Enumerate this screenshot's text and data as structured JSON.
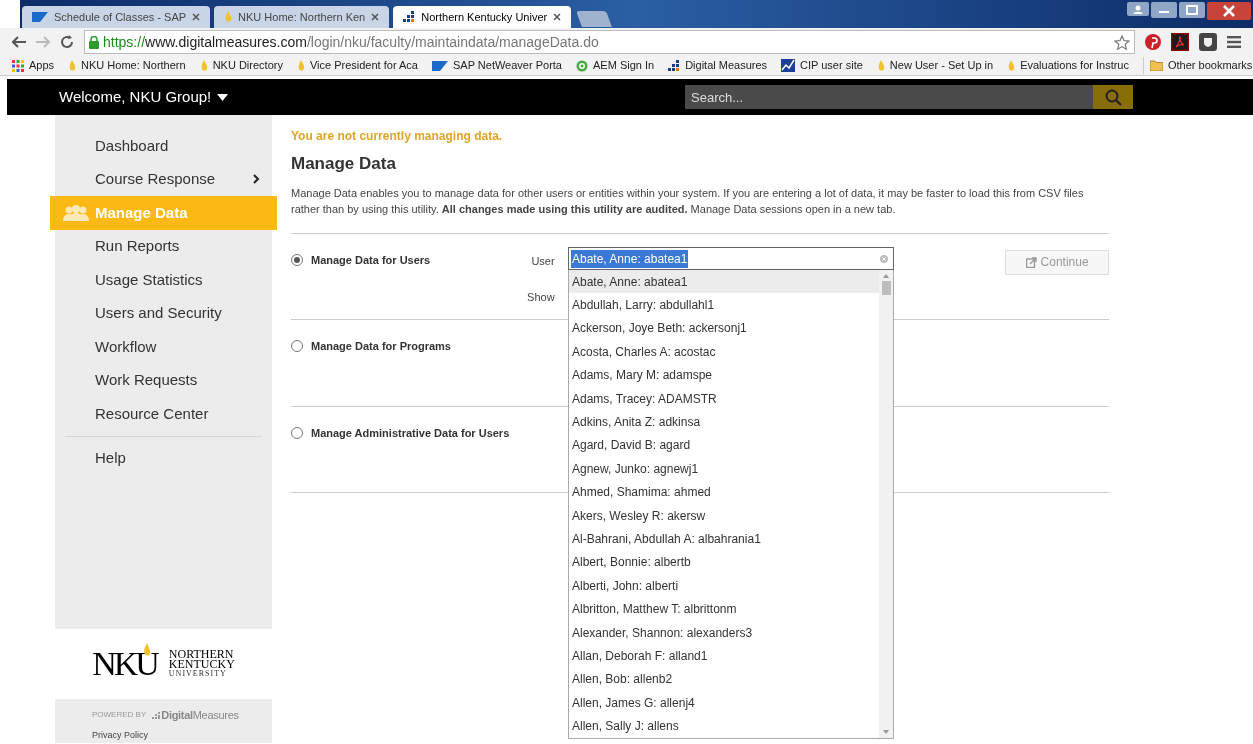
{
  "browser": {
    "tabs": [
      {
        "title": "Schedule of Classes - SAP",
        "kind": "sap",
        "selected": false
      },
      {
        "title": "NKU Home: Northern Ken",
        "kind": "flame",
        "selected": false
      },
      {
        "title": "Northern Kentucky Univer",
        "kind": "dm",
        "selected": true
      }
    ],
    "url_scheme": "https://",
    "url_host": "www.digitalmeasures.com",
    "url_path": "/login/nku/faculty/maintaindata/manageData.do",
    "bookmarks": [
      {
        "label": "Apps",
        "kind": "apps"
      },
      {
        "label": "NKU Home: Northern",
        "kind": "flame"
      },
      {
        "label": "NKU Directory",
        "kind": "flame"
      },
      {
        "label": "Vice President for Aca",
        "kind": "flame"
      },
      {
        "label": "SAP NetWeaver Porta",
        "kind": "sap"
      },
      {
        "label": "AEM Sign In",
        "kind": "aem"
      },
      {
        "label": "Digital Measures",
        "kind": "dm"
      },
      {
        "label": "CIP user site",
        "kind": "cip"
      },
      {
        "label": "New User - Set Up in",
        "kind": "flame"
      },
      {
        "label": "Evaluations for Instruc",
        "kind": "flame"
      }
    ],
    "other_bookmarks": "Other bookmarks"
  },
  "header": {
    "welcome": "Welcome, NKU Group!",
    "search_placeholder": "Search..."
  },
  "sidebar": {
    "items": [
      {
        "label": "Dashboard",
        "selected": false
      },
      {
        "label": "Course Response",
        "selected": false,
        "has_submenu": true
      },
      {
        "label": "Manage Data",
        "selected": true
      },
      {
        "label": "Run Reports",
        "selected": false
      },
      {
        "label": "Usage Statistics",
        "selected": false
      },
      {
        "label": "Users and Security",
        "selected": false
      },
      {
        "label": "Workflow",
        "selected": false
      },
      {
        "label": "Work Requests",
        "selected": false
      },
      {
        "label": "Resource Center",
        "selected": false
      }
    ],
    "help": "Help",
    "powered_by": "POWERED BY",
    "dm_brand": "**Digital**Measures",
    "privacy": "Privacy Policy",
    "logo_mark": "NKU",
    "logo_text": [
      "NORTHERN",
      "KENTUCKY",
      "UNIVERSITY"
    ]
  },
  "main": {
    "notice": "You are not currently managing data.",
    "title": "Manage Data",
    "description": "Manage Data enables you to manage data for other users or entities within your system. If you are entering a lot of data, it may be faster to load this from CSV files rather than by using this utility. **All changes made using this utility are audited.** Manage Data sessions open in a new tab.",
    "options": [
      {
        "label": "Manage Data for Users",
        "selected": true
      },
      {
        "label": "Manage Data for Programs",
        "selected": false
      },
      {
        "label": "Manage Administrative Data for Users",
        "selected": false
      }
    ],
    "user_label": "User",
    "show_label": "Show",
    "user_value": "Abate, Anne: abatea1",
    "continue": "Continue",
    "user_list": [
      {
        "label": "Abate, Anne: abatea1",
        "selected": true
      },
      {
        "label": "Abdullah, Larry: abdullahl1",
        "selected": false
      },
      {
        "label": "Ackerson, Joye Beth: ackersonj1",
        "selected": false
      },
      {
        "label": "Acosta, Charles A: acostac",
        "selected": false
      },
      {
        "label": "Adams, Mary M: adamspe",
        "selected": false
      },
      {
        "label": "Adams, Tracey: ADAMSTR",
        "selected": false
      },
      {
        "label": "Adkins, Anita Z: adkinsa",
        "selected": false
      },
      {
        "label": "Agard, David B: agard",
        "selected": false
      },
      {
        "label": "Agnew, Junko: agnewj1",
        "selected": false
      },
      {
        "label": "Ahmed, Shamima: ahmed",
        "selected": false
      },
      {
        "label": "Akers, Wesley R: akersw",
        "selected": false
      },
      {
        "label": "Al-Bahrani, Abdullah A: albahrania1",
        "selected": false
      },
      {
        "label": "Albert, Bonnie: albertb",
        "selected": false
      },
      {
        "label": "Alberti, John: alberti",
        "selected": false
      },
      {
        "label": "Albritton, Matthew T: albrittonm",
        "selected": false
      },
      {
        "label": "Alexander, Shannon: alexanders3",
        "selected": false
      },
      {
        "label": "Allan, Deborah F: alland1",
        "selected": false
      },
      {
        "label": "Allen, Bob: allenb2",
        "selected": false
      },
      {
        "label": "Allen, James G: allenj4",
        "selected": false
      },
      {
        "label": "Allen, Sally J: allens",
        "selected": false
      }
    ]
  }
}
